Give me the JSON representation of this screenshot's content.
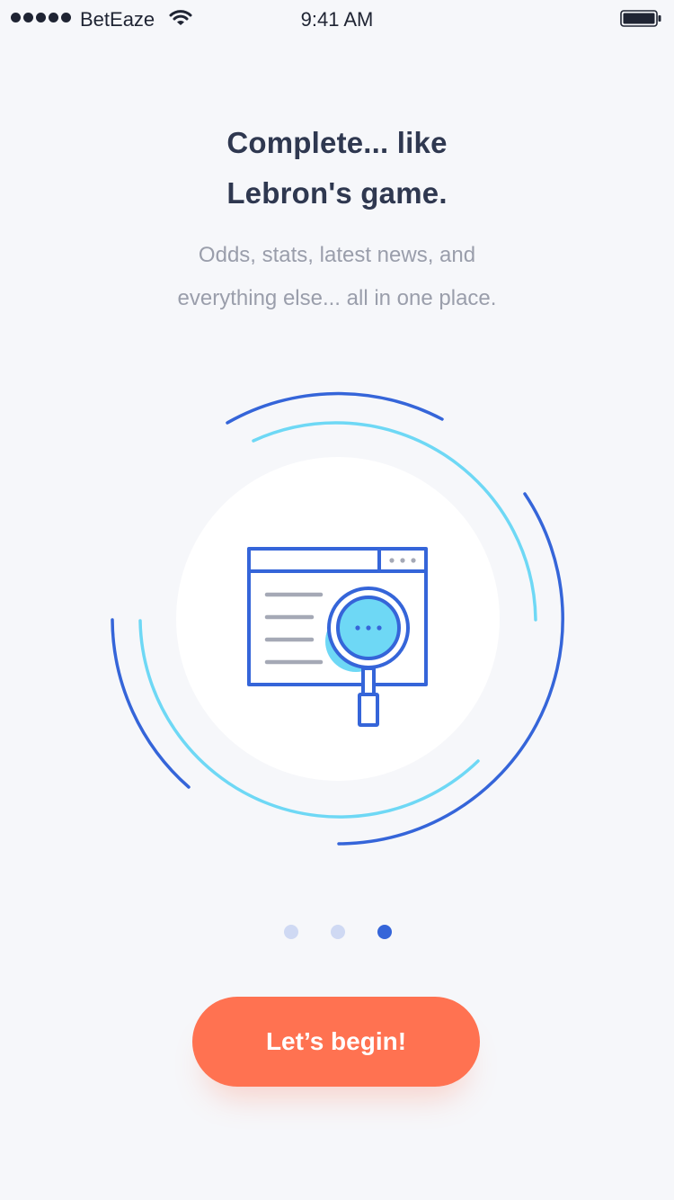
{
  "status_bar": {
    "carrier": "BetEaze",
    "time": "9:41 AM",
    "signal_icon": "signal-dots-icon",
    "wifi_icon": "wifi-icon",
    "battery_icon": "battery-icon"
  },
  "onboarding": {
    "title_line1": "Complete... like",
    "title_line2": "Lebron's game.",
    "subtitle_line1": "Odds, stats, latest news, and",
    "subtitle_line2": "everything else... all in one place.",
    "illustration_icon": "browser-magnifier-icon",
    "pagination": {
      "total": 3,
      "active_index": 2
    },
    "cta_label": "Let’s begin!"
  },
  "colors": {
    "background": "#f6f7fa",
    "title": "#2f3850",
    "subtitle": "#9a9eab",
    "primary_blue": "#3565d9",
    "light_blue": "#6ed8f5",
    "dot_inactive": "#cfd9f3",
    "cta": "#ff7251"
  }
}
